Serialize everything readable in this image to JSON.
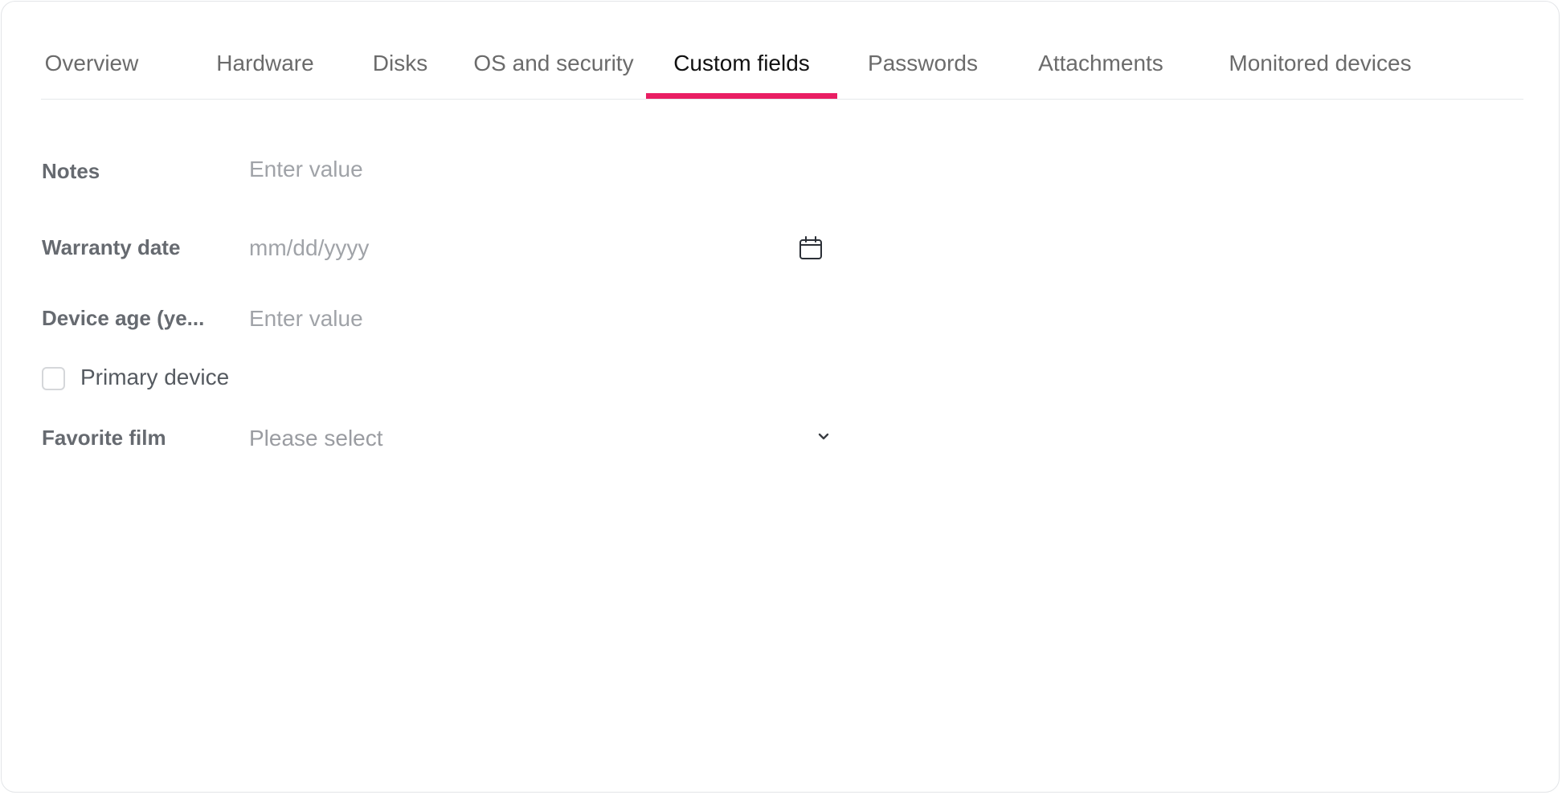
{
  "tabs": [
    {
      "label": "Overview",
      "active": false
    },
    {
      "label": "Hardware",
      "active": false
    },
    {
      "label": "Disks",
      "active": false
    },
    {
      "label": "OS and security",
      "active": false
    },
    {
      "label": "Custom fields",
      "active": true
    },
    {
      "label": "Passwords",
      "active": false
    },
    {
      "label": "Attachments",
      "active": false
    },
    {
      "label": "Monitored devices",
      "active": false
    }
  ],
  "accent_color": "#e91e63",
  "fields": {
    "notes": {
      "label": "Notes",
      "placeholder": "Enter value",
      "value": ""
    },
    "warranty_date": {
      "label": "Warranty date",
      "placeholder": "mm/dd/yyyy",
      "value": "",
      "icon": "calendar-icon"
    },
    "device_age": {
      "label": "Device age (ye...",
      "placeholder": "Enter value",
      "value": ""
    },
    "primary_device": {
      "label": "Primary device",
      "checked": false
    },
    "favorite_film": {
      "label": "Favorite film",
      "selected": "Please select",
      "icon": "chevron-down-icon"
    }
  }
}
